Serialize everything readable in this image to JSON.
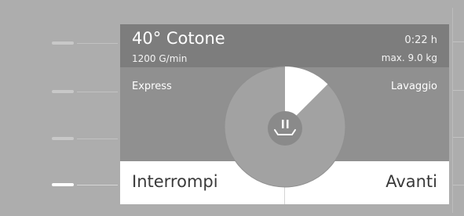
{
  "program": {
    "title": "40° Cotone",
    "spin": "1200 G/min",
    "duration": "0:22 h",
    "max_load": "max. 9.0 kg"
  },
  "options": {
    "left_label": "Express",
    "right_label": "Lavaggio"
  },
  "progress": {
    "fraction": 0.125,
    "icon": "pause-basin-icon"
  },
  "footer": {
    "left_button": "Interrompi",
    "right_button": "Avanti"
  },
  "colors": {
    "background": "#adadad",
    "header": "#7d7d7d",
    "content": "#909090",
    "dial_ring": "#a2a2a2",
    "dial_progress": "#ffffff",
    "dial_center": "#8a8a8a"
  }
}
